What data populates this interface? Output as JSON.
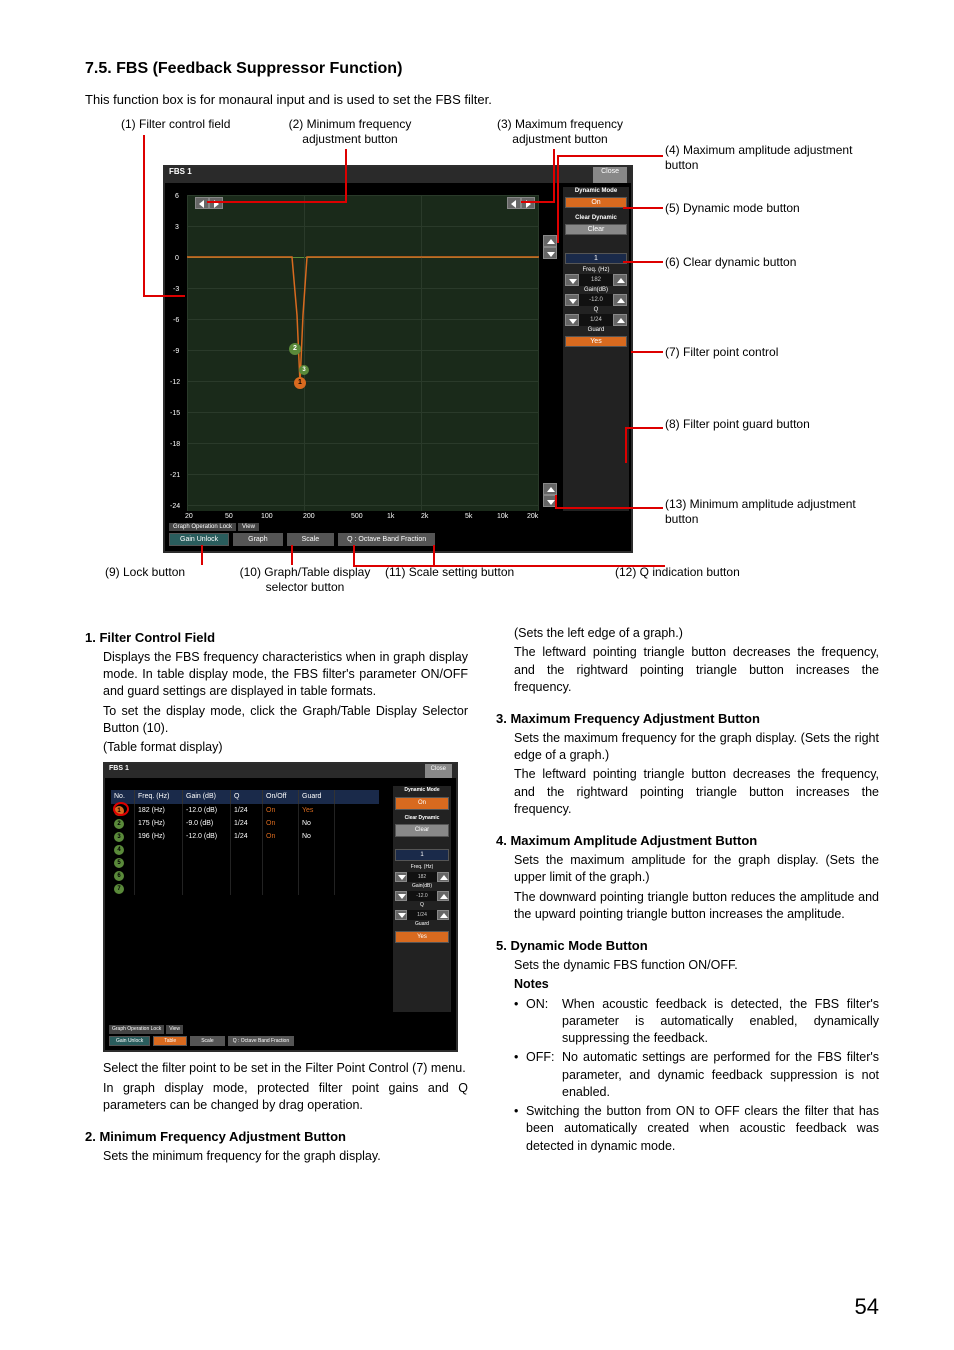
{
  "heading": "7.5. FBS (Feedback Suppressor Function)",
  "intro": "This function box is for monaural input and is used to set the FBS filter.",
  "callouts": {
    "c1": "(1) Filter control field",
    "c2": "(2) Minimum frequency adjustment button",
    "c3": "(3) Maximum frequency adjustment button",
    "c4": "(4) Maximum amplitude adjustment button",
    "c5": "(5) Dynamic mode button",
    "c6": "(6) Clear dynamic button",
    "c7": "(7) Filter point control",
    "c8": "(8) Filter point guard button",
    "c9": "(9) Lock button",
    "c10": "(10) Graph/Table display selector button",
    "c11": "(11) Scale setting button",
    "c12": "(12) Q indication button",
    "c13": "(13) Minimum amplitude adjustment button"
  },
  "screenshot": {
    "title": "FBS 1",
    "close": "Close",
    "dynamic_mode_label": "Dynamic Mode",
    "dynamic_mode_value": "On",
    "clear_dynamic_label": "Clear Dynamic",
    "clear_value": "Clear",
    "filter_no": "1",
    "freq_label": "Freq. (Hz)",
    "freq_value": "182",
    "gain_label": "Gain(dB)",
    "gain_value": "-12.0",
    "q_label": "Q",
    "q_value": "1/24",
    "guard_label": "Guard",
    "guard_value": "Yes",
    "lock_section": "Graph Operation Lock",
    "view_section": "View",
    "gain_unlock": "Gain Unlock",
    "graph_btn": "Graph",
    "scale_btn": "Scale",
    "q_oct_btn": "Q : Octave Band Fraction",
    "y_ticks": [
      "6",
      "3",
      "0",
      "-3",
      "-6",
      "-9",
      "-12",
      "-15",
      "-18",
      "-21",
      "-24"
    ],
    "x_ticks": [
      "20",
      "50",
      "100",
      "200",
      "500",
      "1k",
      "2k",
      "5k",
      "10k",
      "20k"
    ],
    "markers": [
      "1",
      "2",
      "3"
    ]
  },
  "table_shot": {
    "title": "FBS 1",
    "close": "Close",
    "headers": [
      "No.",
      "Freq. (Hz)",
      "Gain (dB)",
      "Q",
      "On/Off",
      "Guard"
    ],
    "rows": [
      [
        "1",
        "182 (Hz)",
        "-12.0 (dB)",
        "1/24",
        "On",
        "Yes"
      ],
      [
        "2",
        "175 (Hz)",
        "-9.0 (dB)",
        "1/24",
        "On",
        "No"
      ],
      [
        "3",
        "196 (Hz)",
        "-12.0 (dB)",
        "1/24",
        "On",
        "No"
      ],
      [
        "4",
        "",
        "",
        "",
        "",
        ""
      ],
      [
        "5",
        "",
        "",
        "",
        "",
        ""
      ],
      [
        "6",
        "",
        "",
        "",
        "",
        ""
      ],
      [
        "7",
        "",
        "",
        "",
        "",
        ""
      ]
    ],
    "side": {
      "dynamic_mode_label": "Dynamic Mode",
      "dynamic_mode_value": "On",
      "clear_dynamic_label": "Clear Dynamic",
      "clear_value": "Clear",
      "filter_no": "1",
      "freq_label": "Freq. (Hz)",
      "freq_value": "182",
      "gain_label": "Gain(dB)",
      "gain_value": "-12.0",
      "q_label": "Q",
      "q_value": "1/24",
      "guard_label": "Guard",
      "guard_value": "Yes"
    },
    "lock_section": "Graph Operation Lock",
    "view_section": "View",
    "gain_unlock": "Gain Unlock",
    "table_btn": "Table",
    "scale_btn": "Scale",
    "q_oct_btn": "Q : Octave Band Fraction"
  },
  "sections": {
    "s1_title": "1. Filter Control Field",
    "s1_p1": "Displays the FBS frequency characteristics when in graph display mode. In table display mode, the FBS filter's parameter ON/OFF and guard settings are displayed in table formats.",
    "s1_p2": "To set the display mode, click the Graph/Table Display Selector Button (10).",
    "s1_p3": "(Table format display)",
    "s1_p4": "Select the filter point to be set in the Filter Point Control (7) menu.",
    "s1_p5": "In graph display mode, protected filter point gains and Q parameters can be changed by drag operation.",
    "s2_title": "2. Minimum Frequency Adjustment Button",
    "s2_p1": "Sets the minimum frequency for the graph display.",
    "r_s2_p1": "(Sets the left edge of a graph.)",
    "r_s2_p2": "The leftward pointing triangle button decreases the frequency, and the rightward pointing triangle button increases the frequency.",
    "s3_title": "3. Maximum Frequency Adjustment Button",
    "s3_p1": "Sets the maximum frequency for the graph display. (Sets the right edge of a graph.)",
    "s3_p2": "The leftward pointing triangle button decreases the frequency, and the rightward pointing triangle button increases the frequency.",
    "s4_title": "4. Maximum Amplitude Adjustment Button",
    "s4_p1": "Sets the maximum amplitude for the graph display. (Sets the upper limit of the graph.)",
    "s4_p2": "The downward pointing triangle button reduces the amplitude and the upward pointing triangle button increases the amplitude.",
    "s5_title": "5. Dynamic Mode Button",
    "s5_p1": "Sets the dynamic FBS function ON/OFF.",
    "s5_notes": "Notes",
    "s5_on": "ON:",
    "s5_on_txt": "When acoustic feedback is detected, the FBS filter's parameter is automatically enabled, dynamically suppressing the feedback.",
    "s5_off": "OFF:",
    "s5_off_txt": "No automatic settings are performed for the FBS filter's parameter, and dynamic feedback suppression is not enabled.",
    "s5_switch": "Switching the button from ON to OFF clears the filter that has been automatically created when acoustic feedback was detected in dynamic mode."
  },
  "page_number": "54"
}
